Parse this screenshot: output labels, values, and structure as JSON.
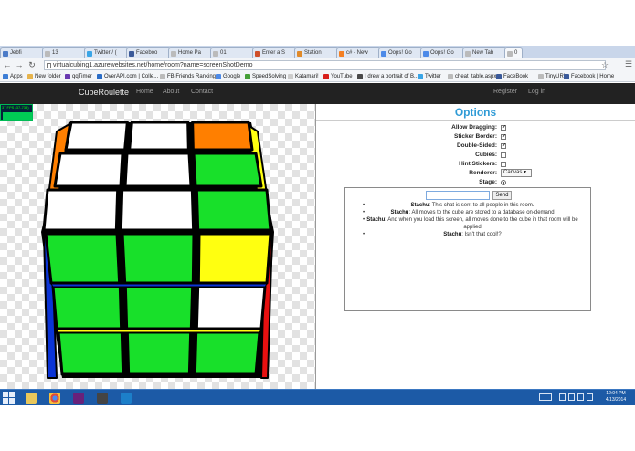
{
  "browser": {
    "tabs": [
      {
        "label": "Jebfi"
      },
      {
        "label": "13"
      },
      {
        "label": "Twitter / ("
      },
      {
        "label": "Faceboo"
      },
      {
        "label": "Home Pa"
      },
      {
        "label": "01"
      },
      {
        "label": "Enter a S"
      },
      {
        "label": "Station"
      },
      {
        "label": "c# - New"
      },
      {
        "label": "Oops! Go"
      },
      {
        "label": "Oops! Go"
      },
      {
        "label": "New Tab"
      },
      {
        "label": "0"
      }
    ],
    "url": "virtualcubing1.azurewebsites.net/home/room?name=screenShotDemo",
    "bookmarks": [
      {
        "label": "Apps",
        "color": "#3d7ed6"
      },
      {
        "label": "New folder",
        "color": "#e6b34c"
      },
      {
        "label": "qqTimer",
        "color": "#6a3ab1"
      },
      {
        "label": "OverAPI.com | Colle...",
        "color": "#2a6dc7"
      },
      {
        "label": "FB Friends Ranking",
        "color": "#bbbbbb"
      },
      {
        "label": "Google",
        "color": "#4d8ae8"
      },
      {
        "label": "SpeedSolving",
        "color": "#46a038"
      },
      {
        "label": "Katamari!",
        "color": "#cccccc"
      },
      {
        "label": "YouTube",
        "color": "#d8201c"
      },
      {
        "label": "I drew a portrait of B...",
        "color": "#4a4a4a"
      },
      {
        "label": "Twitter",
        "color": "#3aa5e6"
      },
      {
        "label": "cheat_table.aspx",
        "color": "#bbbbbb"
      },
      {
        "label": "FaceBook",
        "color": "#3b5a9a"
      },
      {
        "label": "TinyURL",
        "color": "#bbbbbb"
      },
      {
        "label": "Facebook | Home",
        "color": "#3b5a9a"
      }
    ]
  },
  "navbar": {
    "brand": "CubeRoulette",
    "links": [
      "Home",
      "About",
      "Contact"
    ],
    "register": "Register",
    "login": "Log in"
  },
  "stats": {
    "fps_text": "37 FPS (37-738)"
  },
  "options": {
    "title": "Options",
    "rows": [
      {
        "label": "Allow Dragging:",
        "checked": true
      },
      {
        "label": "Sticker Border:",
        "checked": true
      },
      {
        "label": "Double-Sided:",
        "checked": true
      },
      {
        "label": "Cubies:",
        "checked": false
      },
      {
        "label": "Hint Stickers:",
        "checked": false
      }
    ],
    "renderer_label": "Renderer:",
    "renderer_value": "Canvas",
    "stage_label": "Stage:"
  },
  "chat": {
    "input_value": "",
    "send_label": "Send",
    "messages": [
      {
        "user": "Stachu",
        "text": ": This chat is sent to all people in this room."
      },
      {
        "user": "Stachu",
        "text": ": All moves to the cube are stored to a database on-demand"
      },
      {
        "user": "Stachu",
        "text": ": And when you load this screen, all moves done to the cube in that room will be applied"
      },
      {
        "user": "Stachu",
        "text": ": Isn't that cool!?"
      }
    ]
  },
  "colors": {
    "white": "#ffffff",
    "green": "#18e02a",
    "yellow": "#ffff10",
    "orange": "#ff7f00",
    "blue": "#0b34d6",
    "red": "#e81010",
    "frame": "#000000"
  },
  "cube": {
    "top_face": [
      "white",
      "white",
      "orange",
      "white",
      "white",
      "green",
      "white",
      "white",
      "green"
    ],
    "front_face": [
      "green",
      "green",
      "yellow",
      "green",
      "green",
      "white",
      "green",
      "green",
      "green"
    ]
  },
  "taskbar": {
    "apps": [
      "file-explorer",
      "chrome",
      "visual-studio",
      "game",
      "azure"
    ],
    "time": "12:04 PM",
    "date": "4/13/2014"
  }
}
